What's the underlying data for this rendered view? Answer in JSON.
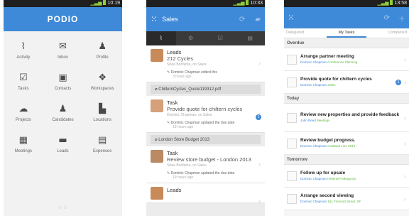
{
  "phone1": {
    "status_time": "10:19",
    "app_title": "PODIO",
    "tiles": [
      {
        "label": "Activity",
        "icon": "activity-icon",
        "glyph": "⌇"
      },
      {
        "label": "Inbox",
        "icon": "inbox-icon",
        "glyph": "✉"
      },
      {
        "label": "Profile",
        "icon": "profile-icon",
        "glyph": "♟"
      },
      {
        "label": "Tasks",
        "icon": "tasks-icon",
        "glyph": "☑"
      },
      {
        "label": "Contacts",
        "icon": "contacts-icon",
        "glyph": "▣"
      },
      {
        "label": "Workspaces",
        "icon": "workspaces-icon",
        "glyph": "❖"
      },
      {
        "label": "Projects",
        "icon": "projects-icon",
        "glyph": "☁"
      },
      {
        "label": "Candidates",
        "icon": "candidates-icon",
        "glyph": "♟"
      },
      {
        "label": "Locations",
        "icon": "locations-icon",
        "glyph": "▙"
      },
      {
        "label": "Meetings",
        "icon": "meetings-icon",
        "glyph": "▦"
      },
      {
        "label": "Leads",
        "icon": "leads-icon",
        "glyph": "▬"
      },
      {
        "label": "Expenses",
        "icon": "expenses-icon",
        "glyph": "▤"
      }
    ]
  },
  "phone2": {
    "status_time": "10:33",
    "header_title": "Sales",
    "tab_icons": [
      "activity-icon",
      "gear-icon",
      "tasks-icon",
      "files-icon"
    ],
    "cards": [
      {
        "title": "Leads",
        "subtitle": "212 Cycles",
        "meta": "Silvia Bonfante, on Sales",
        "activity": "Dominic Chapman edited this",
        "activity_time": "3 hours ago",
        "avatar_color": "#c98a5a",
        "badge": ""
      },
      {
        "title": "Task",
        "subtitle": "Provide quote for chiltern cycles",
        "meta": "Dominic Chapman, on Sales",
        "activity": "Dominic Chapman updated the due date",
        "activity_time": "19 hours ago",
        "avatar_color": "#d6a07a",
        "badge": "1"
      },
      {
        "title": "Task",
        "subtitle": "Review store budget - London 2013",
        "meta": "Silvia Bonfante, on Sales",
        "activity": "Dominic Chapman updated the due date",
        "activity_time": "19 hours ago",
        "avatar_color": "#b98a64",
        "badge": ""
      },
      {
        "title": "Leads",
        "subtitle": "",
        "meta": "",
        "activity": "",
        "activity_time": "",
        "avatar_color": "#c98a5a",
        "badge": ""
      }
    ],
    "files": [
      "ChilternCycles_Quote119312.pdf",
      "London Store Budget 2013"
    ]
  },
  "phone3": {
    "status_time": "13:58",
    "tabs": [
      "Delegated",
      "My Tasks",
      "Completed"
    ],
    "sections": [
      {
        "name": "Overdue",
        "tasks": [
          {
            "title": "Arrange partner meeting",
            "who": "Dominic Chapman",
            "what": "Conference Planning",
            "badge": ""
          },
          {
            "title": "Provide quote for chiltern cycles",
            "who": "Dominic Chapman",
            "what": "Sales",
            "badge": "1"
          }
        ]
      },
      {
        "name": "Today",
        "tasks": [
          {
            "title": "Review new properties and provide feedback",
            "who": "John Reed",
            "what": "Meetings",
            "badge": ""
          },
          {
            "title": "Review budget progress.",
            "who": "Dominic Chapman",
            "what": "Costland Line 2013",
            "badge": ""
          }
        ]
      },
      {
        "name": "Tomorrow",
        "tasks": [
          {
            "title": "Follow up for upsale",
            "who": "Dominic Chapman",
            "what": "Helsinki Polkupyora",
            "badge": ""
          },
          {
            "title": "Arrange second viewing",
            "who": "Dominic Chapman",
            "what": "161 Fremont Street, SF",
            "badge": ""
          }
        ]
      }
    ]
  },
  "colors": {
    "accent": "#3f8ad8",
    "dark_tab": "#3a3a3a",
    "green": "#5cb83f"
  }
}
